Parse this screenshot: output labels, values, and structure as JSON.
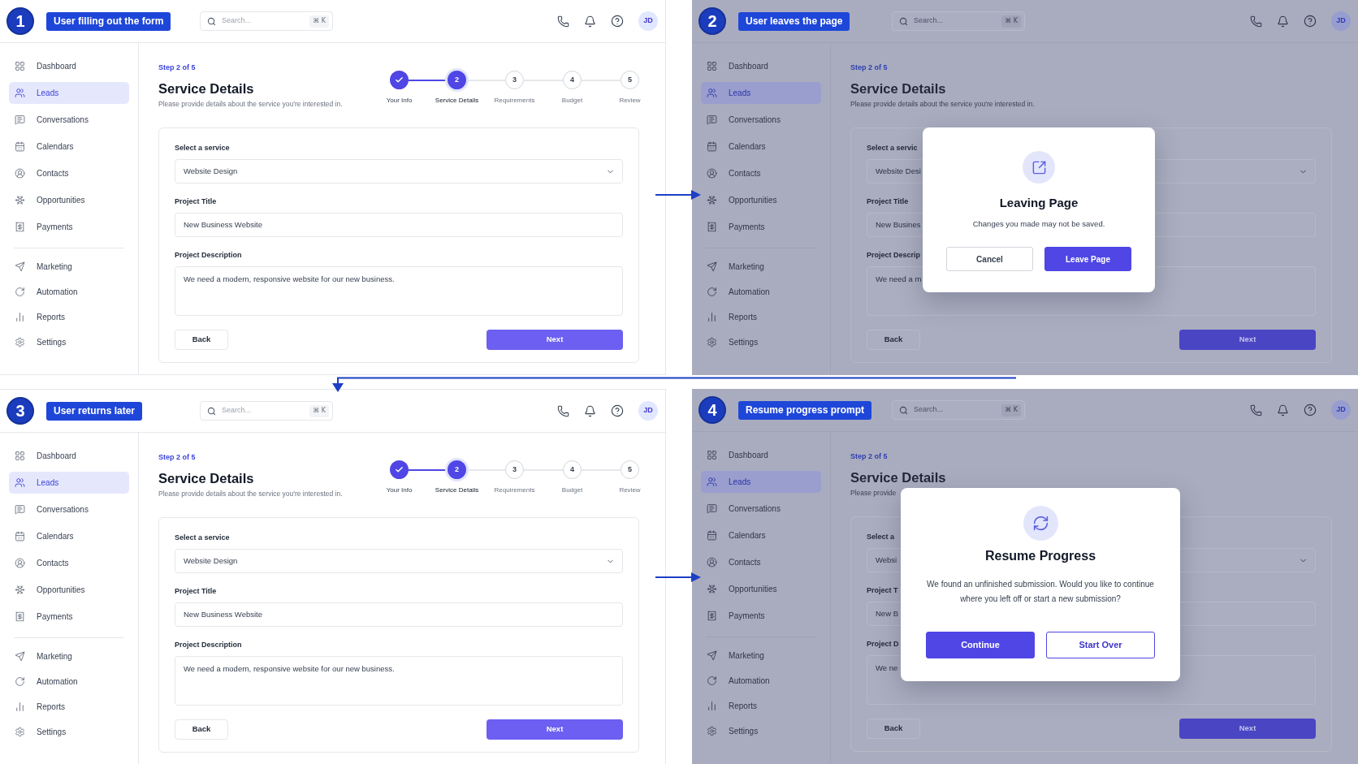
{
  "panels": [
    {
      "step": "1",
      "caption": "User filling out the form",
      "search": {
        "placeholder": "Search...",
        "shortcut": "⌘ K"
      },
      "avatar": "JD",
      "sidebar": {
        "sections": [
          {
            "items": [
              {
                "label": "Dashboard",
                "selected": false
              },
              {
                "label": "Leads",
                "selected": true
              },
              {
                "label": "Conversations",
                "selected": false
              },
              {
                "label": "Calendars",
                "selected": false
              },
              {
                "label": "Contacts",
                "selected": false
              },
              {
                "label": "Opportunities",
                "selected": false
              },
              {
                "label": "Payments",
                "selected": false
              }
            ]
          },
          {
            "items": [
              {
                "label": "Marketing",
                "selected": false
              },
              {
                "label": "Automation",
                "selected": false
              },
              {
                "label": "Reports",
                "selected": false
              },
              {
                "label": "Settings",
                "selected": false
              }
            ]
          }
        ]
      },
      "page": {
        "step_label": "Step 2 of 5",
        "title": "Service Details",
        "description": "Please provide details about the service you're interested in."
      },
      "stepper": [
        {
          "label": "Your Info",
          "completed": true,
          "selected": false
        },
        {
          "number": "2",
          "label": "Service Details",
          "completed": false,
          "selected": true
        },
        {
          "number": "3",
          "label": "Requirements",
          "completed": false,
          "selected": false
        },
        {
          "number": "4",
          "label": "Budget",
          "completed": false,
          "selected": false
        },
        {
          "number": "5",
          "label": "Review",
          "completed": false,
          "selected": false
        }
      ],
      "form": {
        "fields": [
          {
            "kind": "select",
            "label": "Select a service",
            "value": "Website Design"
          },
          {
            "kind": "text",
            "label": "Project Title",
            "value": "New Business Website"
          },
          {
            "kind": "textarea",
            "label": "Project Description",
            "value": "We need a modern, responsive website for our new business."
          }
        ],
        "buttons": [
          {
            "kind": "secondary",
            "label": "Back"
          },
          {
            "kind": "primary",
            "label": "Next"
          }
        ]
      }
    },
    {
      "step": "2",
      "caption": "User leaves the page",
      "search": {
        "placeholder": "Search...",
        "shortcut": "⌘ K"
      },
      "avatar": "JD",
      "sidebar": {
        "sections": [
          {
            "items": [
              {
                "label": "Dashboard",
                "selected": false
              },
              {
                "label": "Leads",
                "selected": true
              },
              {
                "label": "Conversations",
                "selected": false
              },
              {
                "label": "Calendars",
                "selected": false
              },
              {
                "label": "Contacts",
                "selected": false
              },
              {
                "label": "Opportunities",
                "selected": false
              },
              {
                "label": "Payments",
                "selected": false
              }
            ]
          },
          {
            "items": [
              {
                "label": "Marketing",
                "selected": false
              },
              {
                "label": "Automation",
                "selected": false
              },
              {
                "label": "Reports",
                "selected": false
              },
              {
                "label": "Settings",
                "selected": false
              }
            ]
          }
        ]
      },
      "page": {
        "step_label": "Step 2 of 5",
        "title": "Service Details",
        "description": "Please provide details about the service you're interested in."
      },
      "form": {
        "fields": [
          {
            "kind": "select",
            "label": "Select a servic",
            "value": "Website Desi"
          },
          {
            "kind": "text",
            "label": "Project Title",
            "value": "New Busines"
          },
          {
            "kind": "textarea",
            "label": "Project Descrip",
            "value": "We need a m"
          }
        ],
        "buttons": [
          {
            "kind": "secondary",
            "label": "Back"
          },
          {
            "kind": "primary",
            "label": "Next"
          }
        ]
      },
      "dialog": {
        "kind": "leave",
        "title": "Leaving Page",
        "message": "Changes you made may not be saved.",
        "buttons": [
          {
            "kind": "secondary",
            "label": "Cancel"
          },
          {
            "kind": "primary",
            "label": "Leave Page"
          }
        ]
      }
    },
    {
      "step": "3",
      "caption": "User returns later",
      "search": {
        "placeholder": "Search...",
        "shortcut": "⌘ K"
      },
      "avatar": "JD",
      "sidebar": {
        "sections": [
          {
            "items": [
              {
                "label": "Dashboard",
                "selected": false
              },
              {
                "label": "Leads",
                "selected": true
              },
              {
                "label": "Conversations",
                "selected": false
              },
              {
                "label": "Calendars",
                "selected": false
              },
              {
                "label": "Contacts",
                "selected": false
              },
              {
                "label": "Opportunities",
                "selected": false
              },
              {
                "label": "Payments",
                "selected": false
              }
            ]
          },
          {
            "items": [
              {
                "label": "Marketing",
                "selected": false
              },
              {
                "label": "Automation",
                "selected": false
              },
              {
                "label": "Reports",
                "selected": false
              },
              {
                "label": "Settings",
                "selected": false
              }
            ]
          }
        ]
      },
      "page": {
        "step_label": "Step 2 of 5",
        "title": "Service Details",
        "description": "Please provide details about the service you're interested in."
      },
      "stepper": [
        {
          "label": "Your Info",
          "completed": true,
          "selected": false
        },
        {
          "number": "2",
          "label": "Service Details",
          "completed": false,
          "selected": true
        },
        {
          "number": "3",
          "label": "Requirements",
          "completed": false,
          "selected": false
        },
        {
          "number": "4",
          "label": "Budget",
          "completed": false,
          "selected": false
        },
        {
          "number": "5",
          "label": "Review",
          "completed": false,
          "selected": false
        }
      ],
      "form": {
        "fields": [
          {
            "kind": "select",
            "label": "Select a service",
            "value": "Website Design"
          },
          {
            "kind": "text",
            "label": "Project Title",
            "value": "New Business Website"
          },
          {
            "kind": "textarea",
            "label": "Project Description",
            "value": "We need a modern, responsive website for our new business."
          }
        ],
        "buttons": [
          {
            "kind": "secondary",
            "label": "Back"
          },
          {
            "kind": "primary",
            "label": "Next"
          }
        ]
      }
    },
    {
      "step": "4",
      "caption": "Resume progress prompt",
      "search": {
        "placeholder": "Search...",
        "shortcut": "⌘ K"
      },
      "avatar": "JD",
      "sidebar": {
        "sections": [
          {
            "items": [
              {
                "label": "Dashboard",
                "selected": false
              },
              {
                "label": "Leads",
                "selected": true
              },
              {
                "label": "Conversations",
                "selected": false
              },
              {
                "label": "Calendars",
                "selected": false
              },
              {
                "label": "Contacts",
                "selected": false
              },
              {
                "label": "Opportunities",
                "selected": false
              },
              {
                "label": "Payments",
                "selected": false
              }
            ]
          },
          {
            "items": [
              {
                "label": "Marketing",
                "selected": false
              },
              {
                "label": "Automation",
                "selected": false
              },
              {
                "label": "Reports",
                "selected": false
              },
              {
                "label": "Settings",
                "selected": false
              }
            ]
          }
        ]
      },
      "page": {
        "step_label": "Step 2 of 5",
        "title": "Service Details",
        "description": "Please provide"
      },
      "form": {
        "fields": [
          {
            "kind": "select",
            "label": "Select a",
            "value": "Websi"
          },
          {
            "kind": "text",
            "label": "Project T",
            "value": "New B"
          },
          {
            "kind": "textarea",
            "label": "Project D",
            "value": "We ne"
          }
        ],
        "buttons": [
          {
            "kind": "secondary",
            "label": "Back"
          },
          {
            "kind": "primary",
            "label": "Next"
          }
        ]
      },
      "dialog": {
        "kind": "resume",
        "title": "Resume Progress",
        "message": "We found an unfinished submission. Would you like to continue where you left off or start a new submission?",
        "buttons": [
          {
            "kind": "primary",
            "label": "Continue"
          },
          {
            "kind": "outline",
            "label": "Start Over"
          }
        ]
      }
    }
  ]
}
